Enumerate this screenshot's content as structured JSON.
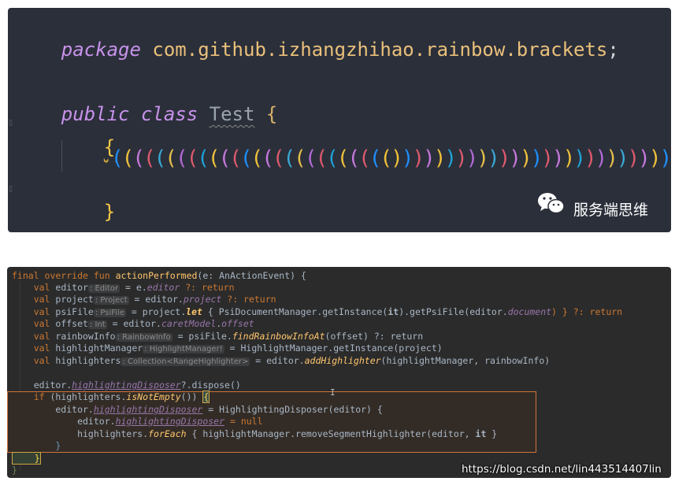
{
  "panel1": {
    "line1": {
      "kw": "package",
      "pkg": "com.github.izhangzhihao.rainbow.brackets",
      "semi": ";"
    },
    "line2": {
      "kw1": "public",
      "kw2": "class",
      "name": "Test",
      "brace": "{"
    },
    "inner_open": "{",
    "inner_close": "}",
    "outer_close": "}",
    "rainbow_colors": [
      "#1e90ff",
      "#f0c23a",
      "#c778dd",
      "#e05a6d",
      "#3aa9d6",
      "#e6c14a",
      "#b56ad8",
      "#e05a6d",
      "#1fa3d8",
      "#f0c23a",
      "#c778dd",
      "#e05a6d",
      "#1e90ff",
      "#f0c23a",
      "#c778dd",
      "#e05a6d",
      "#3aa9d6",
      "#e6c14a",
      "#b56ad8",
      "#e05a6d",
      "#1fa3d8",
      "#f0c23a",
      "#c778dd",
      "#e05a6d",
      "#1e90ff",
      "#f0c23a"
    ],
    "watermark": "服务端思维"
  },
  "panel2": {
    "l1": {
      "a": "final override fun ",
      "b": "actionPerformed",
      "c": "(e: AnActionEvent) {"
    },
    "l2": {
      "a": "    val ",
      "b": "editor",
      "hint": ": Editor",
      "c": " = e.",
      "d": "editor",
      "e": " ?: return"
    },
    "l3": {
      "a": "    val ",
      "b": "project",
      "hint": ": Project",
      "c": " = editor.",
      "d": "project",
      "e": " ?: return"
    },
    "l4": {
      "a": "    val ",
      "b": "psiFile",
      "hint": ": PsiFile",
      "c": " = project.",
      "d": "let",
      "e": " { PsiDocumentManager.getInstance(",
      "f": "it",
      "g": ").getPsiFile(editor.",
      "h": "document",
      "i": ") } ?: return"
    },
    "l5": {
      "a": "    val ",
      "b": "offset",
      "hint": ": Int",
      "c": " = editor.",
      "d": "caretModel",
      "e": ".",
      "f": "offset"
    },
    "l6": {
      "a": "    val ",
      "b": "rainbowInfo",
      "hint": ": RainbowInfo",
      "c": " = psiFile.",
      "d": "findRainbowInfoAt",
      "e": "(offset) ?: return"
    },
    "l7": {
      "a": "    val ",
      "b": "highlightManager",
      "hint": ": HighlightManager!",
      "c": " = HighlightManager.getInstance(project)"
    },
    "l8": {
      "a": "    val ",
      "b": "highlighters",
      "hint": ": Collection<RangeHighlighter>",
      "c": " = editor.",
      "d": "addHighlighter",
      "e": "(highlightManager, rainbowInfo)"
    },
    "l9": {
      "a": "    editor.",
      "b": "highlightingDisposer",
      "c": "?.dispose()"
    },
    "l10": {
      "a": "    if ",
      "b": "(highlighters.",
      "c": "isNotEmpty",
      "d": "()) ",
      "e": "{"
    },
    "l11": {
      "a": "        editor.",
      "b": "highlightingDisposer",
      "c": " = HighlightingDisposer(editor) {"
    },
    "l12": {
      "a": "            editor.",
      "b": "highlightingDisposer",
      "c": " = null"
    },
    "l13": {
      "a": "            highlighters.",
      "b": "forEach",
      "c": " { highlightManager.removeSegmentHighlighter(editor, ",
      "d": "it",
      "e": " }"
    },
    "l14": {
      "a": "        }"
    },
    "l15": {
      "a": "    }"
    },
    "l16": {
      "a": "}"
    },
    "caret_glyph": "I",
    "url": "https://blog.csdn.net/lin443514407lin"
  }
}
